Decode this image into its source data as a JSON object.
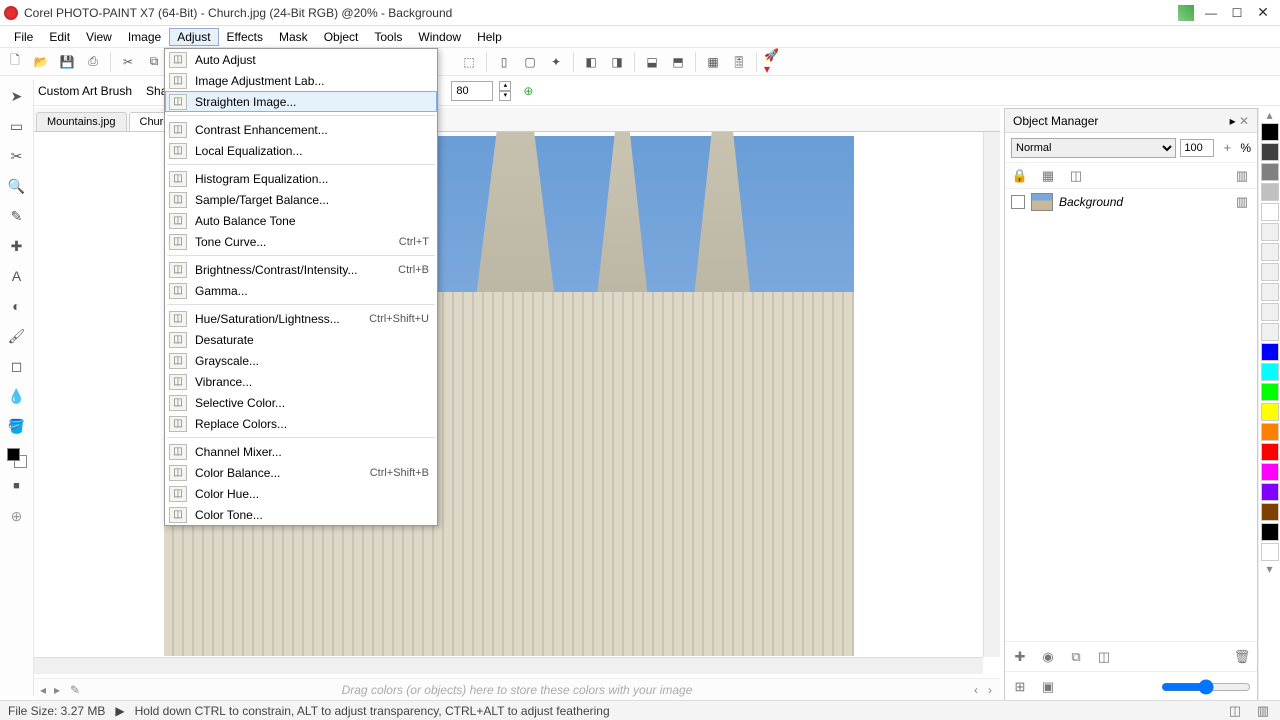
{
  "titlebar": {
    "title": "Corel PHOTO-PAINT X7 (64-Bit) - Church.jpg (24-Bit RGB) @20% - Background"
  },
  "menubar": {
    "items": [
      "File",
      "Edit",
      "View",
      "Image",
      "Adjust",
      "Effects",
      "Mask",
      "Object",
      "Tools",
      "Window",
      "Help"
    ],
    "active_index": 4
  },
  "propbar": {
    "brush_label": "Custom Art Brush",
    "shape_label": "Sha",
    "value": "80"
  },
  "doctabs": {
    "items": [
      "Mountains.jpg",
      "Churc"
    ]
  },
  "adjust_menu": {
    "groups": [
      [
        {
          "label": "Auto Adjust",
          "shortcut": ""
        },
        {
          "label": "Image Adjustment Lab...",
          "shortcut": ""
        },
        {
          "label": "Straighten Image...",
          "shortcut": "",
          "hover": true
        }
      ],
      [
        {
          "label": "Contrast Enhancement...",
          "shortcut": ""
        },
        {
          "label": "Local Equalization...",
          "shortcut": ""
        }
      ],
      [
        {
          "label": "Histogram Equalization...",
          "shortcut": ""
        },
        {
          "label": "Sample/Target Balance...",
          "shortcut": ""
        },
        {
          "label": "Auto Balance Tone",
          "shortcut": ""
        },
        {
          "label": "Tone Curve...",
          "shortcut": "Ctrl+T"
        }
      ],
      [
        {
          "label": "Brightness/Contrast/Intensity...",
          "shortcut": "Ctrl+B"
        },
        {
          "label": "Gamma...",
          "shortcut": ""
        }
      ],
      [
        {
          "label": "Hue/Saturation/Lightness...",
          "shortcut": "Ctrl+Shift+U"
        },
        {
          "label": "Desaturate",
          "shortcut": ""
        },
        {
          "label": "Grayscale...",
          "shortcut": ""
        },
        {
          "label": "Vibrance...",
          "shortcut": ""
        },
        {
          "label": "Selective Color...",
          "shortcut": ""
        },
        {
          "label": "Replace Colors...",
          "shortcut": ""
        }
      ],
      [
        {
          "label": "Channel Mixer...",
          "shortcut": ""
        },
        {
          "label": "Color Balance...",
          "shortcut": "Ctrl+Shift+B"
        },
        {
          "label": "Color Hue...",
          "shortcut": ""
        },
        {
          "label": "Color Tone...",
          "shortcut": ""
        }
      ]
    ]
  },
  "object_manager": {
    "title": "Object Manager",
    "blend_mode": "Normal",
    "opacity": "100",
    "opacity_unit": "%",
    "layer": {
      "name": "Background"
    }
  },
  "swatches": [
    "#000000",
    "#404040",
    "#808080",
    "#c0c0c0",
    "#ffffff",
    "#f0f0f0",
    "#f0f0f0",
    "#f0f0f0",
    "#f0f0f0",
    "#f0f0f0",
    "#f0f0f0",
    "#0000ff",
    "#00ffff",
    "#00ff00",
    "#ffff00",
    "#ff8000",
    "#ff0000",
    "#ff00ff",
    "#8000ff",
    "#804000",
    "#000000",
    "#ffffff"
  ],
  "colortray": {
    "hint": "Drag colors (or objects) here to store these colors with your image"
  },
  "statusbar": {
    "filesize_label": "File Size: 3.27 MB",
    "hint": "Hold down CTRL to constrain, ALT to adjust transparency, CTRL+ALT to adjust feathering"
  }
}
